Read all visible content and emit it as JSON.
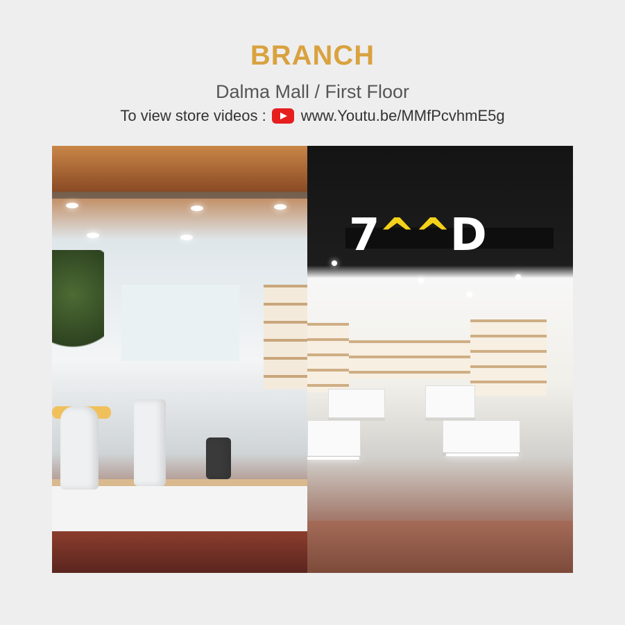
{
  "header": {
    "title": "BRANCH",
    "location": "Dalma Mall / First Floor",
    "videos_label": "To view store videos :",
    "video_url": "www.Youtu.be/MMfPcvhmE5g"
  },
  "icons": {
    "video": "youtube-icon"
  },
  "store_sign": {
    "part1": "7",
    "part2": "^^",
    "part3": "D"
  },
  "colors": {
    "title": "#d9a23f",
    "youtube": "#e61e1e",
    "background": "#eeeeef"
  }
}
